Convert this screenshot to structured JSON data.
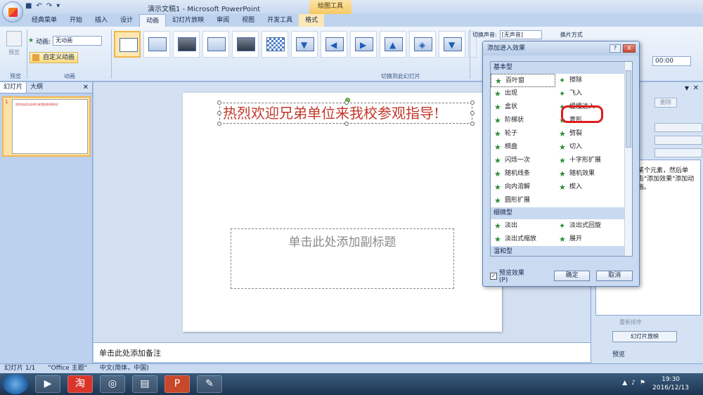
{
  "titlebar": {
    "title": "演示文稿1 - Microsoft PowerPoint",
    "context_tab_title": "绘图工具"
  },
  "tabs": [
    "经典菜单",
    "开始",
    "插入",
    "设计",
    "动画",
    "幻灯片放映",
    "审阅",
    "视图",
    "开发工具",
    "格式"
  ],
  "ribbon": {
    "preview_label": "预览",
    "preview_group": "预览",
    "animation_label": "动画:",
    "animation_value": "无动画",
    "custom_animation": "自定义动画",
    "animation_group": "动画",
    "transition_group": "切换到此幻灯片",
    "sound_label": "切换声音:",
    "sound_value": "[无声音]",
    "advance_label": "换片方式",
    "time_value": "00:00"
  },
  "left_pane": {
    "tab_slides": "幻灯片",
    "tab_outline": "大纲",
    "slide_number": "1",
    "thumb_text": "热烈欢迎兄弟单位来我校参观指导！"
  },
  "slide": {
    "title": "热烈欢迎兄弟单位来我校参观指导!",
    "subtitle_placeholder": "单击此处添加副标题"
  },
  "notes": {
    "placeholder": "单击此处添加备注"
  },
  "task_pane": {
    "remove_label": "删除",
    "help_text": "某个元素，然后单击\"添加效果\"添加动画。",
    "reorder_label": "重新排序",
    "slideshow_button": "幻灯片放映",
    "preview_label": "预览"
  },
  "dialog": {
    "title": "添加进入效果",
    "help_button": "?",
    "close_button": "X",
    "categories": [
      {
        "name": "基本型",
        "items": [
          {
            "left": "百叶窗",
            "right": "擦除"
          },
          {
            "left": "出现",
            "right": "飞入"
          },
          {
            "left": "盒状",
            "right": "缓慢进入"
          },
          {
            "left": "阶梯状",
            "right": "菱形"
          },
          {
            "left": "轮子",
            "right": "劈裂"
          },
          {
            "left": "棋盘",
            "right": "切入"
          },
          {
            "left": "闪烁一次",
            "right": "十字形扩展"
          },
          {
            "left": "随机线条",
            "right": "随机效果"
          },
          {
            "left": "向内溶解",
            "right": "楔入"
          },
          {
            "left": "圆形扩展",
            "right": ""
          }
        ]
      },
      {
        "name": "细微型",
        "items": [
          {
            "left": "淡出",
            "right": "淡出式回旋"
          },
          {
            "left": "淡出式缩放",
            "right": "展开"
          }
        ]
      },
      {
        "name": "温和型",
        "items": []
      }
    ],
    "preview_checkbox": "预览效果(P)",
    "ok_button": "确定",
    "cancel_button": "取消"
  },
  "statusbar": {
    "slide_info": "幻灯片 1/1",
    "theme": "\"Office 主题\"",
    "language": "中文(简体，中国)"
  },
  "taskbar": {
    "time": "19:30",
    "date": "2016/12/13"
  },
  "icons": {
    "effect_icon": "green-star-icon",
    "office_button": "office-logo-icon"
  }
}
